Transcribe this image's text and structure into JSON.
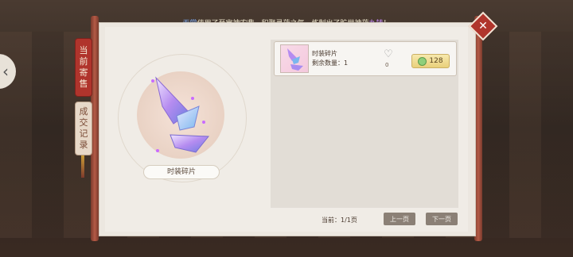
{
  "banner": {
    "name": "无常",
    "text_mid": "使用了至宝神农鼎，积聚灵药之气，炼制出了旷世神药",
    "highlight": "九转",
    "end": "！"
  },
  "tabs": {
    "current_sale": "当前寄售",
    "transaction_history": "成交记录"
  },
  "item": {
    "name": "时装碎片"
  },
  "listing": {
    "name": "时装碎片",
    "qty_label": "剩余数量：",
    "qty_value": "1",
    "likes": "0",
    "price": "128"
  },
  "pagination": {
    "label": "当前：",
    "value": "1/1页",
    "prev": "上一页",
    "next": "下一页"
  },
  "icons": {
    "close": "close-icon",
    "heart": "heart-icon",
    "coin": "coin-icon",
    "arrow": "chevron-left-icon"
  },
  "colors": {
    "tab_active": "#b0342c",
    "price_bg": "#e9d07b",
    "button": "#8b8076"
  }
}
